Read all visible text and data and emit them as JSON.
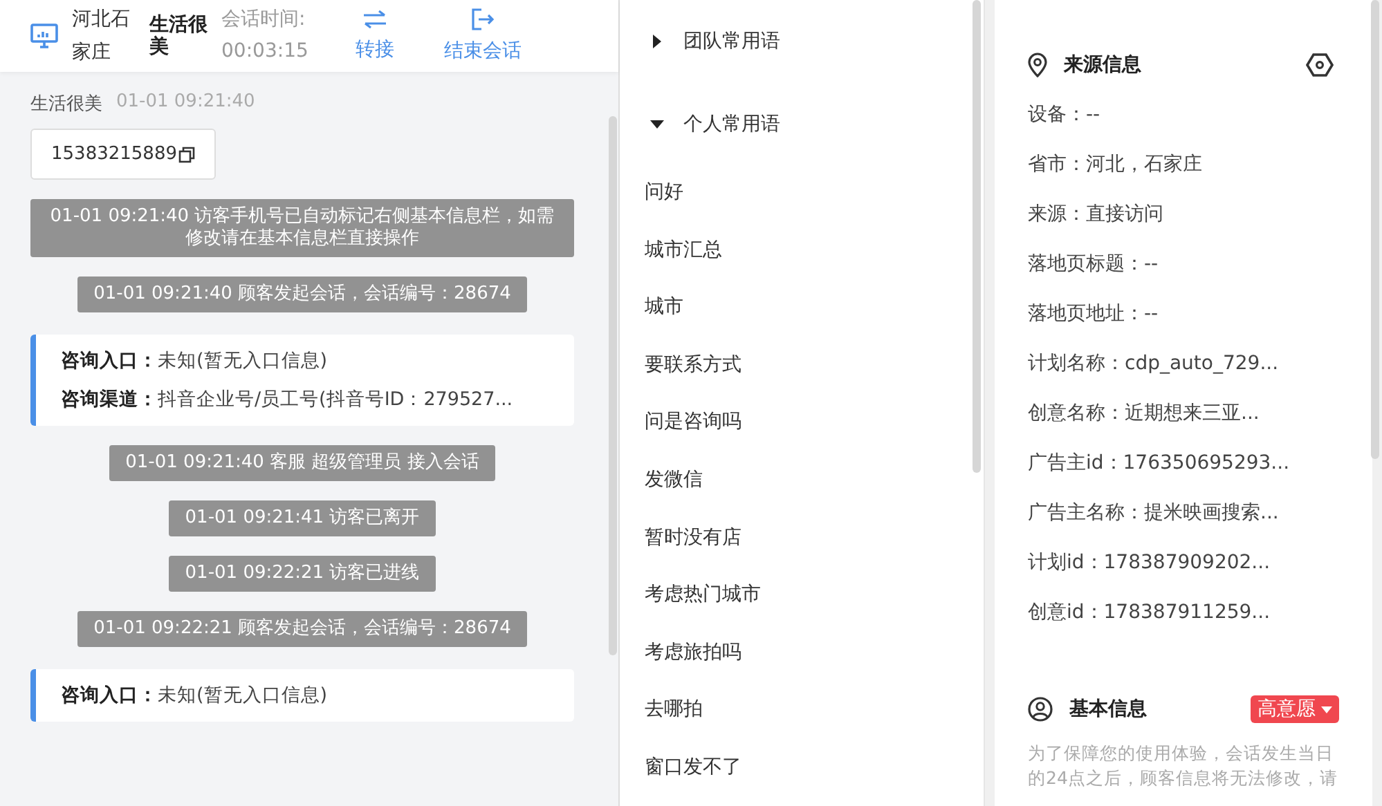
{
  "header": {
    "location": "河北石家庄",
    "name": "生活很美",
    "timer_label": "会话时间:",
    "timer_value": "00:03:15",
    "actions": [
      {
        "kind": "transfer",
        "label": "转接"
      },
      {
        "kind": "end",
        "label": "结束会话"
      }
    ]
  },
  "messages": [
    {
      "kind": "visitor",
      "sender": "生活很美",
      "time": "01-01 09:21:40",
      "text": "15383215889"
    },
    {
      "kind": "system",
      "text": "01-01 09:21:40 访客手机号已自动标记右侧基本信息栏，如需修改请在基本信息栏直接操作"
    },
    {
      "kind": "system",
      "text": "01-01 09:21:40 顾客发起会话，会话编号：28674"
    },
    {
      "kind": "card",
      "rows": [
        {
          "label": "咨询入口：",
          "value": "未知(暂无入口信息)"
        },
        {
          "label": "咨询渠道：",
          "value": "抖音企业号/员工号(抖音号ID：279527..."
        }
      ]
    },
    {
      "kind": "system",
      "text": "01-01 09:21:40 客服 超级管理员 接入会话"
    },
    {
      "kind": "system",
      "text": "01-01 09:21:41 访客已离开"
    },
    {
      "kind": "system",
      "text": "01-01 09:22:21 访客已进线"
    },
    {
      "kind": "system",
      "text": "01-01 09:22:21 顾客发起会话，会话编号：28674"
    },
    {
      "kind": "card",
      "rows": [
        {
          "label": "咨询入口：",
          "value": "未知(暂无入口信息)"
        }
      ]
    }
  ],
  "phrases": [
    {
      "label": "团队常用语",
      "expanded": false
    },
    {
      "label": "个人常用语",
      "expanded": true,
      "children": [
        "问好",
        "城市汇总",
        "城市",
        "要联系方式",
        "问是咨询吗",
        "发微信",
        "暂时没有店",
        "考虑热门城市",
        "考虑旅拍吗",
        "去哪拍",
        "窗口发不了"
      ]
    }
  ],
  "source_info": {
    "title": "来源信息",
    "fields": [
      "设备：--",
      "省市：河北，石家庄",
      "来源：直接访问",
      "落地页标题：--",
      "落地页地址：--",
      "计划名称：cdp_auto_729...",
      "创意名称：近期想来三亚...",
      "广告主id：176350695293...",
      "广告主名称：提米映画搜索...",
      "计划id：178387909202...",
      "创意id：178387911259..."
    ]
  },
  "basic_info": {
    "title": "基本信息",
    "tag": "高意愿",
    "notice": "为了保障您的使用体验，会话发生当日的24点之后，顾客信息将无法修改，请"
  }
}
